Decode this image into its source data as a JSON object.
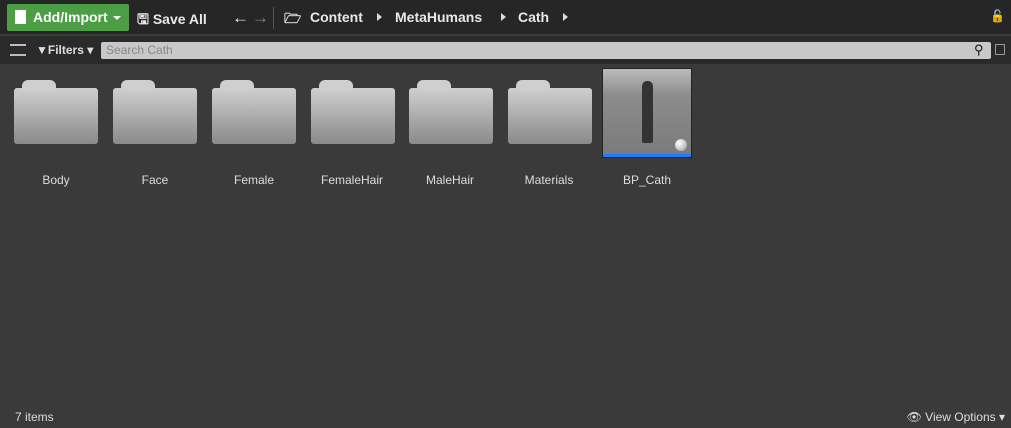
{
  "toolbar": {
    "add_import": "Add/Import",
    "save_all": "Save All"
  },
  "breadcrumb": [
    "Content",
    "MetaHumans",
    "Cath"
  ],
  "filters": "Filters",
  "search_placeholder": "Search Cath",
  "items": [
    "Body",
    "Face",
    "Female",
    "FemaleHair",
    "MaleHair",
    "Materials",
    "BP_Cath"
  ],
  "status": "7 items",
  "view_options": "View Options",
  "colors": {
    "accent": "#4b9e44",
    "selection": "#1f7bff"
  }
}
